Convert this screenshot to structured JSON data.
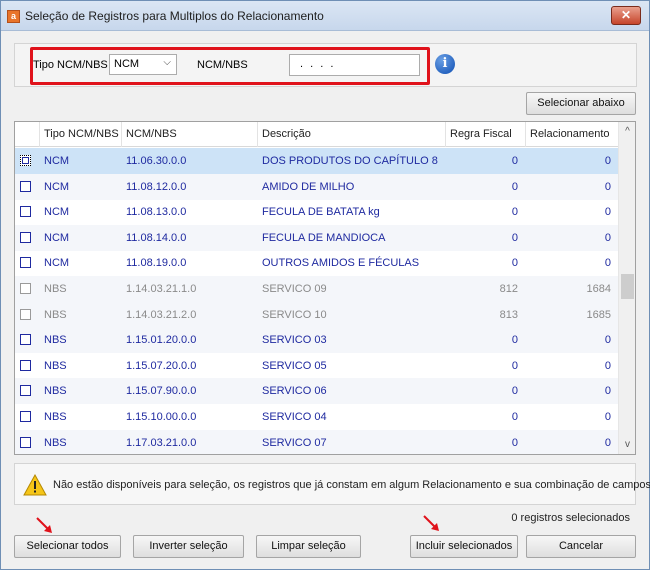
{
  "window": {
    "title": "Seleção de Registros para Multiplos do Relacionamento",
    "close_glyph": "✕",
    "app_icon_glyph": "a"
  },
  "filter": {
    "tipo_label": "Tipo NCM/NBS",
    "tipo_value": "NCM",
    "ncm_label": "NCM/NBS",
    "ncm_value": ". . . .",
    "info_glyph": "i"
  },
  "buttons": {
    "selecionar_abaixo": "Selecionar abaixo",
    "selecionar_todos": "Selecionar todos",
    "inverter_selecao": "Inverter seleção",
    "limpar_selecao": "Limpar seleção",
    "incluir_selecionados": "Incluir selecionados",
    "cancelar": "Cancelar"
  },
  "grid": {
    "columns": [
      "Tipo NCM/NBS",
      "NCM/NBS",
      "Descrição",
      "Regra Fiscal",
      "Relacionamento"
    ],
    "rows": [
      {
        "tipo": "NCM",
        "codigo": "11.06.30.0.0",
        "descricao": "DOS PRODUTOS DO CAPÍTULO 8",
        "regra": "0",
        "relac": "0",
        "state": "selected"
      },
      {
        "tipo": "NCM",
        "codigo": "11.08.12.0.0",
        "descricao": "AMIDO DE MILHO",
        "regra": "0",
        "relac": "0",
        "state": "normal"
      },
      {
        "tipo": "NCM",
        "codigo": "11.08.13.0.0",
        "descricao": "FECULA DE BATATA kg",
        "regra": "0",
        "relac": "0",
        "state": "normal"
      },
      {
        "tipo": "NCM",
        "codigo": "11.08.14.0.0",
        "descricao": "FECULA DE MANDIOCA",
        "regra": "0",
        "relac": "0",
        "state": "normal"
      },
      {
        "tipo": "NCM",
        "codigo": "11.08.19.0.0",
        "descricao": "OUTROS AMIDOS E FÉCULAS",
        "regra": "0",
        "relac": "0",
        "state": "normal"
      },
      {
        "tipo": "NBS",
        "codigo": "1.14.03.21.1.0",
        "descricao": "SERVICO 09",
        "regra": "812",
        "relac": "1684",
        "state": "disabled"
      },
      {
        "tipo": "NBS",
        "codigo": "1.14.03.21.2.0",
        "descricao": "SERVICO 10",
        "regra": "813",
        "relac": "1685",
        "state": "disabled"
      },
      {
        "tipo": "NBS",
        "codigo": "1.15.01.20.0.0",
        "descricao": "SERVICO 03",
        "regra": "0",
        "relac": "0",
        "state": "normal"
      },
      {
        "tipo": "NBS",
        "codigo": "1.15.07.20.0.0",
        "descricao": "SERVICO 05",
        "regra": "0",
        "relac": "0",
        "state": "normal"
      },
      {
        "tipo": "NBS",
        "codigo": "1.15.07.90.0.0",
        "descricao": "SERVICO 06",
        "regra": "0",
        "relac": "0",
        "state": "normal"
      },
      {
        "tipo": "NBS",
        "codigo": "1.15.10.00.0.0",
        "descricao": "SERVICO 04",
        "regra": "0",
        "relac": "0",
        "state": "normal"
      },
      {
        "tipo": "NBS",
        "codigo": "1.17.03.21.0.0",
        "descricao": "SERVICO 07",
        "regra": "0",
        "relac": "0",
        "state": "normal"
      }
    ],
    "scroll_up_glyph": "^",
    "scroll_down_glyph": "v"
  },
  "warning": {
    "text": "Não estão disponíveis para seleção, os registros que já constam em algum Relacionamento e sua combinação de campos."
  },
  "status": {
    "selected_count": "0 registros selecionados"
  },
  "colors": {
    "highlight_red": "#e0121b",
    "selected_row": "#cde3f7",
    "link_blue": "#1f2aa0"
  }
}
